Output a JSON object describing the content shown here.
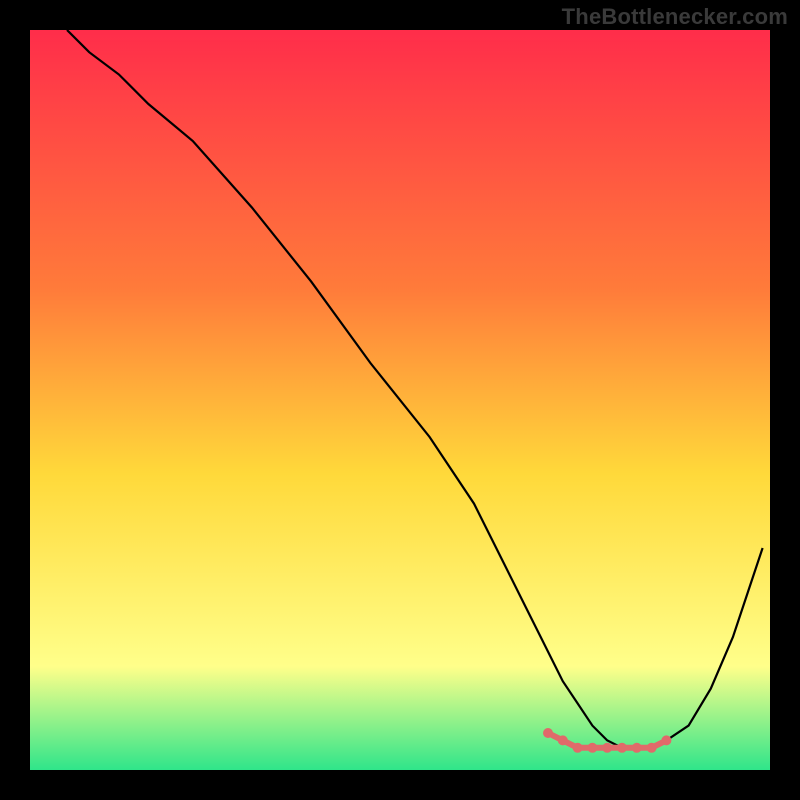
{
  "watermark": "TheBottlenecker.com",
  "chart_data": {
    "type": "line",
    "title": "",
    "xlabel": "",
    "ylabel": "",
    "xlim": [
      0,
      100
    ],
    "ylim": [
      0,
      100
    ],
    "grid": false,
    "legend": false,
    "background_gradient": {
      "top": "#ff2d4a",
      "mid1": "#ff7b3a",
      "mid2": "#ffd93a",
      "yellow": "#ffff8a",
      "bottom": "#2fe58a"
    },
    "series": [
      {
        "name": "bottleneck_curve",
        "x": [
          5,
          8,
          12,
          16,
          22,
          30,
          38,
          46,
          54,
          60,
          64,
          67,
          70,
          72,
          74,
          76,
          78,
          80,
          82,
          84,
          86,
          89,
          92,
          95,
          97,
          99
        ],
        "y": [
          100,
          97,
          94,
          90,
          85,
          76,
          66,
          55,
          45,
          36,
          28,
          22,
          16,
          12,
          9,
          6,
          4,
          3,
          3,
          3,
          4,
          6,
          11,
          18,
          24,
          30
        ],
        "color": "#000000"
      },
      {
        "name": "optimal_zone",
        "x": [
          70,
          72,
          74,
          76,
          78,
          80,
          82,
          84,
          86
        ],
        "y": [
          5,
          4,
          3,
          3,
          3,
          3,
          3,
          3,
          4
        ],
        "color": "#e06a6a",
        "marker": true
      }
    ]
  }
}
